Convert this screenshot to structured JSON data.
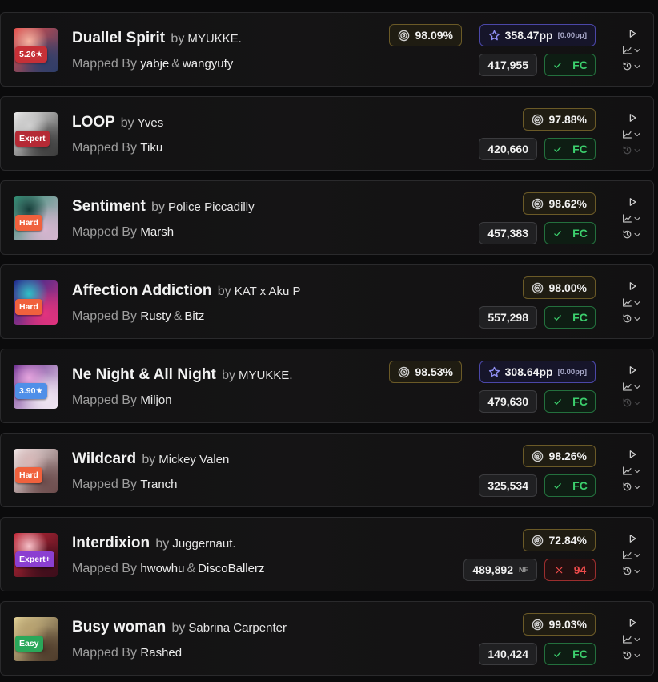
{
  "colors": {
    "accuracy_border": "#6b5a27",
    "pp_border": "#4b47a8",
    "fc_green": "#3ccf6d",
    "miss_red": "#ee4b4b",
    "diff_expert": "#b52a35",
    "diff_hard": "#f0613d",
    "diff_expert_plus": "#8b3fd1",
    "diff_easy": "#2aa85a",
    "diff_star_red": "#c73037",
    "diff_star_blue": "#4f8fe8"
  },
  "scores": [
    {
      "title": "Duallel Spirit",
      "by": "by",
      "artist": "MYUKKE.",
      "mapped_by_label": "Mapped By",
      "mappers": [
        "yabje",
        "wangyufy"
      ],
      "mapper_sep": "&",
      "difficulty": "5.26★",
      "difficulty_color": "#c73037",
      "cover_colors": [
        "#e84f4a",
        "#f6b3a1",
        "#2c3e6a"
      ],
      "accuracy": "98.09%",
      "pp": "358.47pp",
      "pp_weighted": "[0.00pp]",
      "score": "417,955",
      "modifier": "",
      "result": "FC",
      "result_icon": "check-icon",
      "replay_available": true
    },
    {
      "title": "LOOP",
      "by": "by",
      "artist": "Yves",
      "mapped_by_label": "Mapped By",
      "mappers": [
        "Tiku"
      ],
      "mapper_sep": "&",
      "difficulty": "Expert",
      "difficulty_color": "#b52a35",
      "cover_colors": [
        "#eeeeee",
        "#cfcfcf",
        "#3a3a3a"
      ],
      "accuracy": "97.88%",
      "pp": "",
      "pp_weighted": "",
      "score": "420,660",
      "modifier": "",
      "result": "FC",
      "result_icon": "check-icon",
      "replay_available": false
    },
    {
      "title": "Sentiment",
      "by": "by",
      "artist": "Police Piccadilly",
      "mapped_by_label": "Mapped By",
      "mappers": [
        "Marsh"
      ],
      "mapper_sep": "&",
      "difficulty": "Hard",
      "difficulty_color": "#f0613d",
      "cover_colors": [
        "#2f8e73",
        "#163e3a",
        "#d7b6d0"
      ],
      "accuracy": "98.62%",
      "pp": "",
      "pp_weighted": "",
      "score": "457,383",
      "modifier": "",
      "result": "FC",
      "result_icon": "check-icon",
      "replay_available": true
    },
    {
      "title": "Affection Addiction",
      "by": "by",
      "artist": "KAT x Aku P",
      "mapped_by_label": "Mapped By",
      "mappers": [
        "Rusty",
        "Bitz"
      ],
      "mapper_sep": "&",
      "difficulty": "Hard",
      "difficulty_color": "#f0613d",
      "cover_colors": [
        "#1b2a8f",
        "#2ec1c7",
        "#e3337d"
      ],
      "accuracy": "98.00%",
      "pp": "",
      "pp_weighted": "",
      "score": "557,298",
      "modifier": "",
      "result": "FC",
      "result_icon": "check-icon",
      "replay_available": true
    },
    {
      "title": "Ne Night & All Night",
      "by": "by",
      "artist": "MYUKKE.",
      "mapped_by_label": "Mapped By",
      "mappers": [
        "Miljon"
      ],
      "mapper_sep": "&",
      "difficulty": "3.90★",
      "difficulty_color": "#4f8fe8",
      "cover_colors": [
        "#6a2a8e",
        "#e5a4de",
        "#f2eaf4"
      ],
      "accuracy": "98.53%",
      "pp": "308.64pp",
      "pp_weighted": "[0.00pp]",
      "score": "479,630",
      "modifier": "",
      "result": "FC",
      "result_icon": "check-icon",
      "replay_available": false
    },
    {
      "title": "Wildcard",
      "by": "by",
      "artist": "Mickey Valen",
      "mapped_by_label": "Mapped By",
      "mappers": [
        "Tranch"
      ],
      "mapper_sep": "&",
      "difficulty": "Hard",
      "difficulty_color": "#f0613d",
      "cover_colors": [
        "#f4eaea",
        "#d8b7b7",
        "#6b4b4b"
      ],
      "accuracy": "98.26%",
      "pp": "",
      "pp_weighted": "",
      "score": "325,534",
      "modifier": "",
      "result": "FC",
      "result_icon": "check-icon",
      "replay_available": true
    },
    {
      "title": "Interdixion",
      "by": "by",
      "artist": "Juggernaut.",
      "mapped_by_label": "Mapped By",
      "mappers": [
        "hwowhu",
        "DiscoBallerz"
      ],
      "mapper_sep": "&",
      "difficulty": "Expert+",
      "difficulty_color": "#8b3fd1",
      "cover_colors": [
        "#c72a3a",
        "#f6c0c8",
        "#3b0d1a"
      ],
      "accuracy": "72.84%",
      "pp": "",
      "pp_weighted": "",
      "score": "489,892",
      "modifier": "NF",
      "result": "94",
      "result_icon": "x-icon",
      "replay_available": true
    },
    {
      "title": "Busy woman",
      "by": "by",
      "artist": "Sabrina Carpenter",
      "mapped_by_label": "Mapped By",
      "mappers": [
        "Rashed"
      ],
      "mapper_sep": "&",
      "difficulty": "Easy",
      "difficulty_color": "#2aa85a",
      "cover_colors": [
        "#e6d59a",
        "#b7a16f",
        "#4d3a2a"
      ],
      "accuracy": "99.03%",
      "pp": "",
      "pp_weighted": "",
      "score": "140,424",
      "modifier": "",
      "result": "FC",
      "result_icon": "check-icon",
      "replay_available": true
    }
  ]
}
